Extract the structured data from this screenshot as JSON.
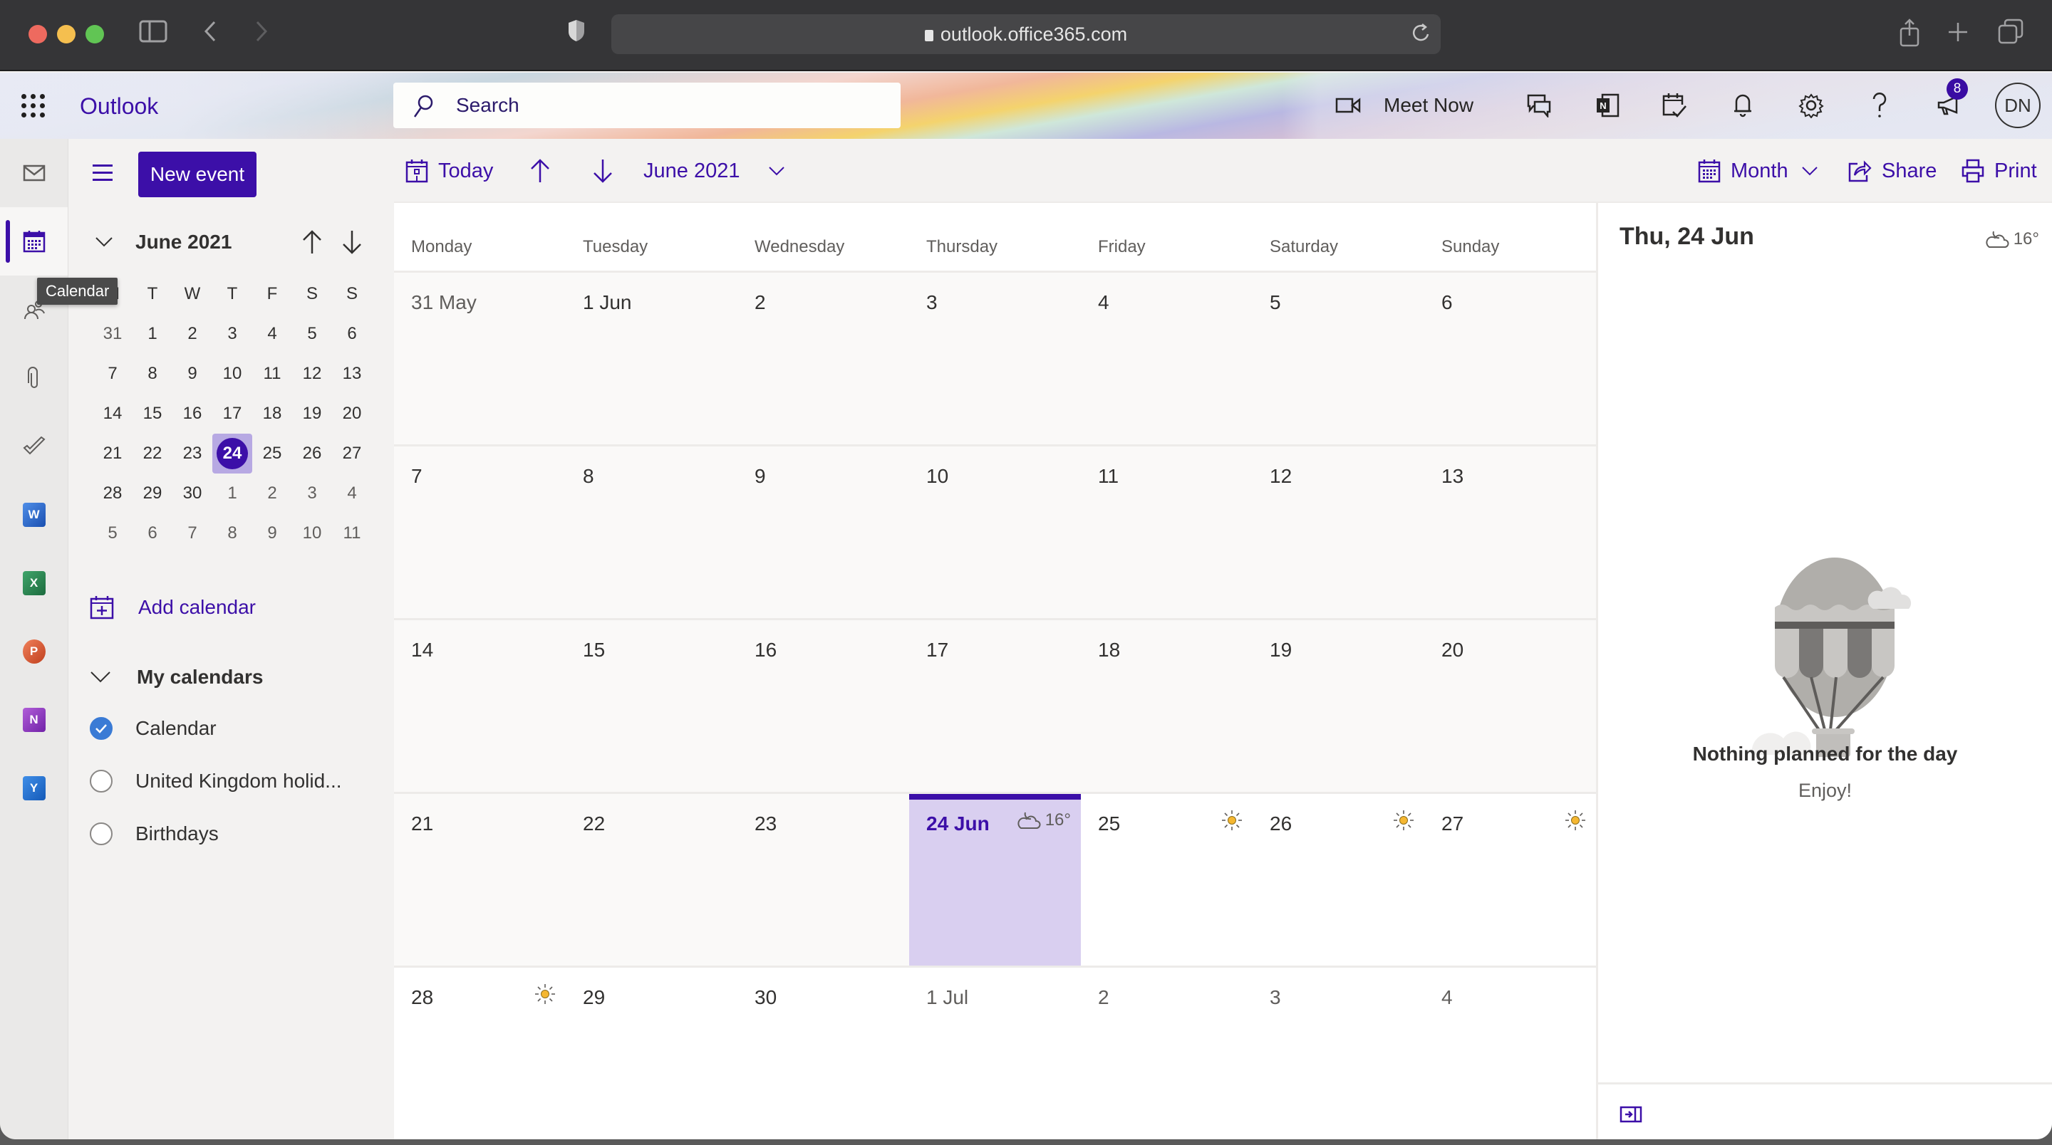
{
  "browser": {
    "url": "outlook.office365.com"
  },
  "header": {
    "app_name": "Outlook",
    "search_placeholder": "Search",
    "meet_now_label": "Meet Now",
    "notification_badge": "8",
    "avatar_initials": "DN"
  },
  "rail": {
    "tooltip": "Calendar",
    "items": [
      {
        "name": "mail",
        "label": "Mail"
      },
      {
        "name": "calendar",
        "label": "Calendar",
        "active": true
      },
      {
        "name": "people",
        "label": "People"
      },
      {
        "name": "files",
        "label": "Files"
      },
      {
        "name": "todo",
        "label": "To Do"
      },
      {
        "name": "word",
        "label": "W"
      },
      {
        "name": "excel",
        "label": "X"
      },
      {
        "name": "powerpoint",
        "label": "P"
      },
      {
        "name": "onenote",
        "label": "N"
      },
      {
        "name": "yammer",
        "label": "Y"
      }
    ]
  },
  "left_pane": {
    "new_event_label": "New event",
    "mini_calendar": {
      "title": "June 2021",
      "weekdays": [
        "M",
        "T",
        "W",
        "T",
        "F",
        "S",
        "S"
      ],
      "weeks": [
        [
          "31",
          "1",
          "2",
          "3",
          "4",
          "5",
          "6"
        ],
        [
          "7",
          "8",
          "9",
          "10",
          "11",
          "12",
          "13"
        ],
        [
          "14",
          "15",
          "16",
          "17",
          "18",
          "19",
          "20"
        ],
        [
          "21",
          "22",
          "23",
          "24",
          "25",
          "26",
          "27"
        ],
        [
          "28",
          "29",
          "30",
          "1",
          "2",
          "3",
          "4"
        ],
        [
          "5",
          "6",
          "7",
          "8",
          "9",
          "10",
          "11"
        ]
      ],
      "selected": "24"
    },
    "add_calendar_label": "Add calendar",
    "my_calendars_title": "My calendars",
    "calendars": [
      {
        "label": "Calendar",
        "checked": true,
        "color": "#3a7bd5"
      },
      {
        "label": "United Kingdom holid...",
        "checked": false
      },
      {
        "label": "Birthdays",
        "checked": false
      }
    ]
  },
  "toolbar": {
    "today_label": "Today",
    "period_label": "June 2021",
    "view_label": "Month",
    "share_label": "Share",
    "print_label": "Print"
  },
  "month_view": {
    "weekdays": [
      "Monday",
      "Tuesday",
      "Wednesday",
      "Thursday",
      "Friday",
      "Saturday",
      "Sunday"
    ],
    "weeks": [
      [
        {
          "label": "31 May",
          "state": "past other"
        },
        {
          "label": "1 Jun",
          "state": "past"
        },
        {
          "label": "2",
          "state": "past"
        },
        {
          "label": "3",
          "state": "past"
        },
        {
          "label": "4",
          "state": "past"
        },
        {
          "label": "5",
          "state": "past"
        },
        {
          "label": "6",
          "state": "past"
        }
      ],
      [
        {
          "label": "7",
          "state": "past"
        },
        {
          "label": "8",
          "state": "past"
        },
        {
          "label": "9",
          "state": "past"
        },
        {
          "label": "10",
          "state": "past"
        },
        {
          "label": "11",
          "state": "past"
        },
        {
          "label": "12",
          "state": "past"
        },
        {
          "label": "13",
          "state": "past"
        }
      ],
      [
        {
          "label": "14",
          "state": "past"
        },
        {
          "label": "15",
          "state": "past"
        },
        {
          "label": "16",
          "state": "past"
        },
        {
          "label": "17",
          "state": "past"
        },
        {
          "label": "18",
          "state": "past"
        },
        {
          "label": "19",
          "state": "past"
        },
        {
          "label": "20",
          "state": "past"
        }
      ],
      [
        {
          "label": "21",
          "state": "past"
        },
        {
          "label": "22",
          "state": "past"
        },
        {
          "label": "23",
          "state": "past"
        },
        {
          "label": "24 Jun",
          "state": "today",
          "weather": "night-cloudy",
          "temp": "16°"
        },
        {
          "label": "25",
          "state": "future",
          "weather": "sunny"
        },
        {
          "label": "26",
          "state": "future",
          "weather": "sunny"
        },
        {
          "label": "27",
          "state": "future",
          "weather": "sunny"
        }
      ],
      [
        {
          "label": "28",
          "state": "future",
          "weather": "sunny"
        },
        {
          "label": "29",
          "state": "future"
        },
        {
          "label": "30",
          "state": "future"
        },
        {
          "label": "1 Jul",
          "state": "future other"
        },
        {
          "label": "2",
          "state": "future other"
        },
        {
          "label": "3",
          "state": "future other"
        },
        {
          "label": "4",
          "state": "future other"
        }
      ]
    ]
  },
  "day_panel": {
    "title": "Thu, 24 Jun",
    "weather_icon": "night-cloudy",
    "temperature": "16°",
    "empty_title": "Nothing planned for the day",
    "empty_subtitle": "Enjoy!"
  },
  "colors": {
    "brand": "#3c0fa8",
    "today_fill": "#d9cff0",
    "mini_selected_bg": "#b7a9e3",
    "calendar_check": "#3a7bd5",
    "sun": "#f5b731"
  }
}
